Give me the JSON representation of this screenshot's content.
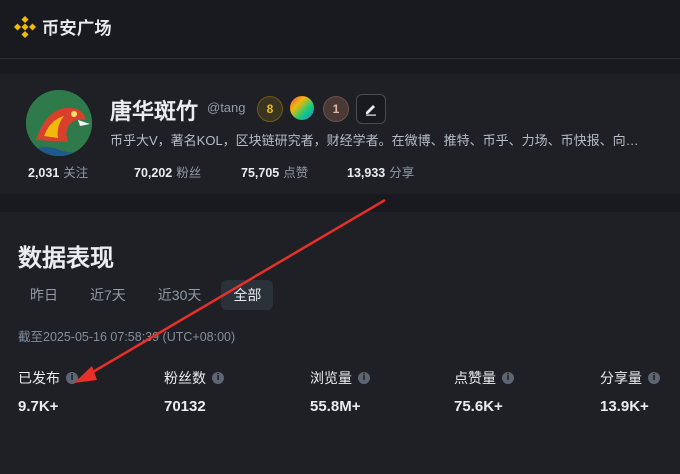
{
  "brand": {
    "name": "币安广场",
    "color": "#f0b90b"
  },
  "profile": {
    "display_name": "唐华斑竹",
    "handle": "@tang",
    "badges": [
      {
        "icon": "medal-8-icon",
        "text": "8"
      },
      {
        "icon": "rainbow-shield-icon",
        "text": ""
      },
      {
        "icon": "rank-1-icon",
        "text": "1"
      }
    ],
    "bio": "币乎大V，著名KOL，区块链研究者，财经学者。在微博、推特、币乎、力场、币快报、向…",
    "stats": [
      {
        "value": "2,031",
        "label": "关注"
      },
      {
        "value": "70,202",
        "label": "粉丝"
      },
      {
        "value": "75,705",
        "label": "点赞"
      },
      {
        "value": "13,933",
        "label": "分享"
      }
    ]
  },
  "analytics": {
    "title": "数据表现",
    "tabs": [
      {
        "label": "昨日",
        "active": false
      },
      {
        "label": "近7天",
        "active": false
      },
      {
        "label": "近30天",
        "active": false
      },
      {
        "label": "全部",
        "active": true
      }
    ],
    "timestamp": "截至2025-05-16 07:58:39 (UTC+08:00)",
    "metrics": [
      {
        "label": "已发布",
        "value": "9.7K+"
      },
      {
        "label": "粉丝数",
        "value": "70132"
      },
      {
        "label": "浏览量",
        "value": "55.8M+"
      },
      {
        "label": "点赞量",
        "value": "75.6K+"
      },
      {
        "label": "分享量",
        "value": "13.9K+"
      }
    ]
  },
  "annotation": {
    "arrow_color": "#e8302a"
  }
}
